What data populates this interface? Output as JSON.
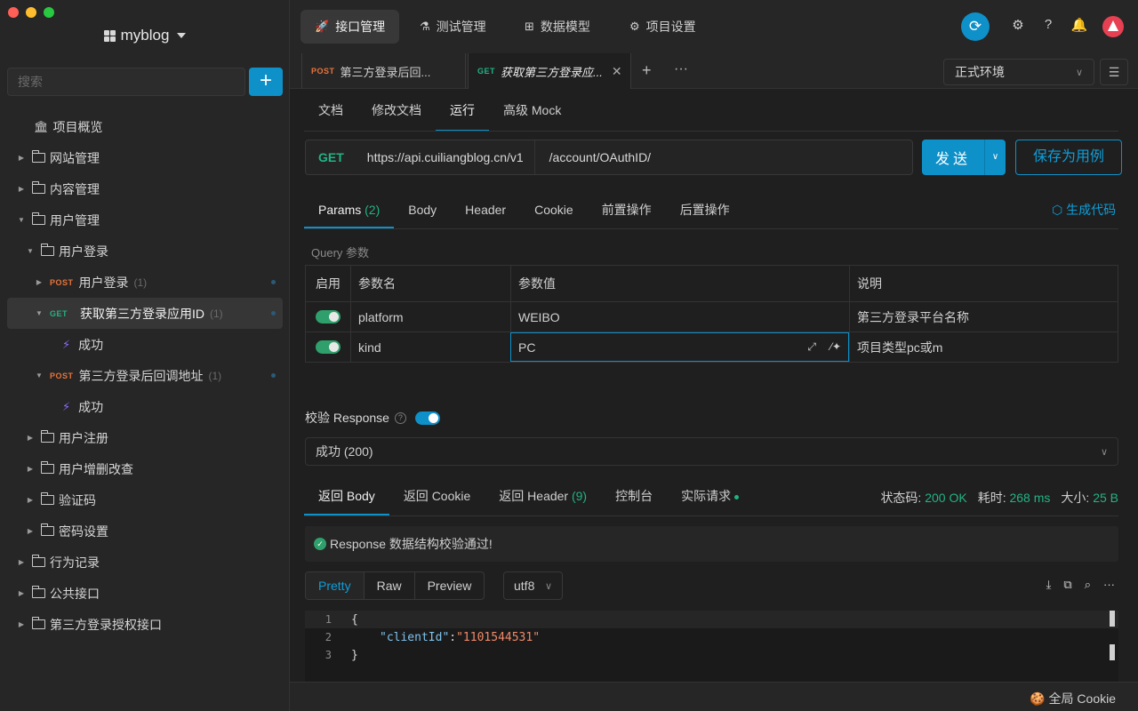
{
  "sidebar": {
    "project_name": "myblog",
    "search_placeholder": "搜索",
    "add_label": "+",
    "tree": [
      {
        "label": "项目概览",
        "type": "overview"
      },
      {
        "label": "网站管理",
        "type": "folder"
      },
      {
        "label": "内容管理",
        "type": "folder"
      },
      {
        "label": "用户管理",
        "type": "folder",
        "expanded": true
      },
      {
        "label": "用户登录",
        "type": "folder",
        "expanded": true
      },
      {
        "method": "POST",
        "label": "用户登录",
        "count": "(1)"
      },
      {
        "method": "GET",
        "label": "获取第三方登录应用ID",
        "count": "(1)",
        "active": true
      },
      {
        "label": "成功",
        "type": "case"
      },
      {
        "method": "POST",
        "label": "第三方登录后回调地址",
        "count": "(1)"
      },
      {
        "label": "成功",
        "type": "case"
      },
      {
        "label": "用户注册",
        "type": "folder"
      },
      {
        "label": "用户增删改查",
        "type": "folder"
      },
      {
        "label": "验证码",
        "type": "folder"
      },
      {
        "label": "密码设置",
        "type": "folder"
      },
      {
        "label": "行为记录",
        "type": "folder"
      },
      {
        "label": "公共接口",
        "type": "folder"
      },
      {
        "label": "第三方登录授权接口",
        "type": "folder"
      }
    ]
  },
  "topnav": {
    "tabs": [
      {
        "label": "接口管理",
        "icon": "rocket-icon"
      },
      {
        "label": "测试管理",
        "icon": "flask-icon"
      },
      {
        "label": "数据模型",
        "icon": "model-icon"
      },
      {
        "label": "项目设置",
        "icon": "gear-icon"
      }
    ]
  },
  "request_tabs": {
    "tab1_method": "POST",
    "tab1_title": "第三方登录后回...",
    "tab2_method": "GET",
    "tab2_title": "获取第三方登录应...",
    "environment": "正式环境"
  },
  "subtabs": [
    "文档",
    "修改文档",
    "运行",
    "高级 Mock"
  ],
  "request": {
    "method": "GET",
    "base_url": "https://api.cuiliangblog.cn/v1",
    "path": "/account/OAuthID/",
    "send_label": "发送",
    "save_label": "保存为用例"
  },
  "param_tabs": {
    "params_label": "Params",
    "params_count": "(2)",
    "body": "Body",
    "header": "Header",
    "cookie": "Cookie",
    "pre": "前置操作",
    "post": "后置操作",
    "gen_code": "生成代码"
  },
  "query": {
    "label": "Query 参数",
    "headers": [
      "启用",
      "参数名",
      "参数值",
      "说明"
    ],
    "rows": [
      {
        "name": "platform",
        "value": "WEIBO",
        "desc": "第三方登录平台名称"
      },
      {
        "name": "kind",
        "value": "PC",
        "desc": "项目类型pc或m"
      }
    ]
  },
  "verify": {
    "label": "校验 Response",
    "selected": "成功 (200)"
  },
  "response_tabs": {
    "body": "返回 Body",
    "cookie": "返回 Cookie",
    "header": "返回 Header",
    "header_count": "(9)",
    "console": "控制台",
    "actual": "实际请求",
    "status_label": "状态码:",
    "status_value": "200 OK",
    "time_label": "耗时:",
    "time_value": "268 ms",
    "size_label": "大小:",
    "size_value": "25 B"
  },
  "validation_message": "Response 数据结构校验通过!",
  "format": {
    "pretty": "Pretty",
    "raw": "Raw",
    "preview": "Preview",
    "encoding": "utf8"
  },
  "code": {
    "line1": "{",
    "key": "\"clientId\"",
    "colon": ": ",
    "value": "\"1101544531\"",
    "line3": "}"
  },
  "footer": {
    "cookie_label": "全局 Cookie"
  }
}
